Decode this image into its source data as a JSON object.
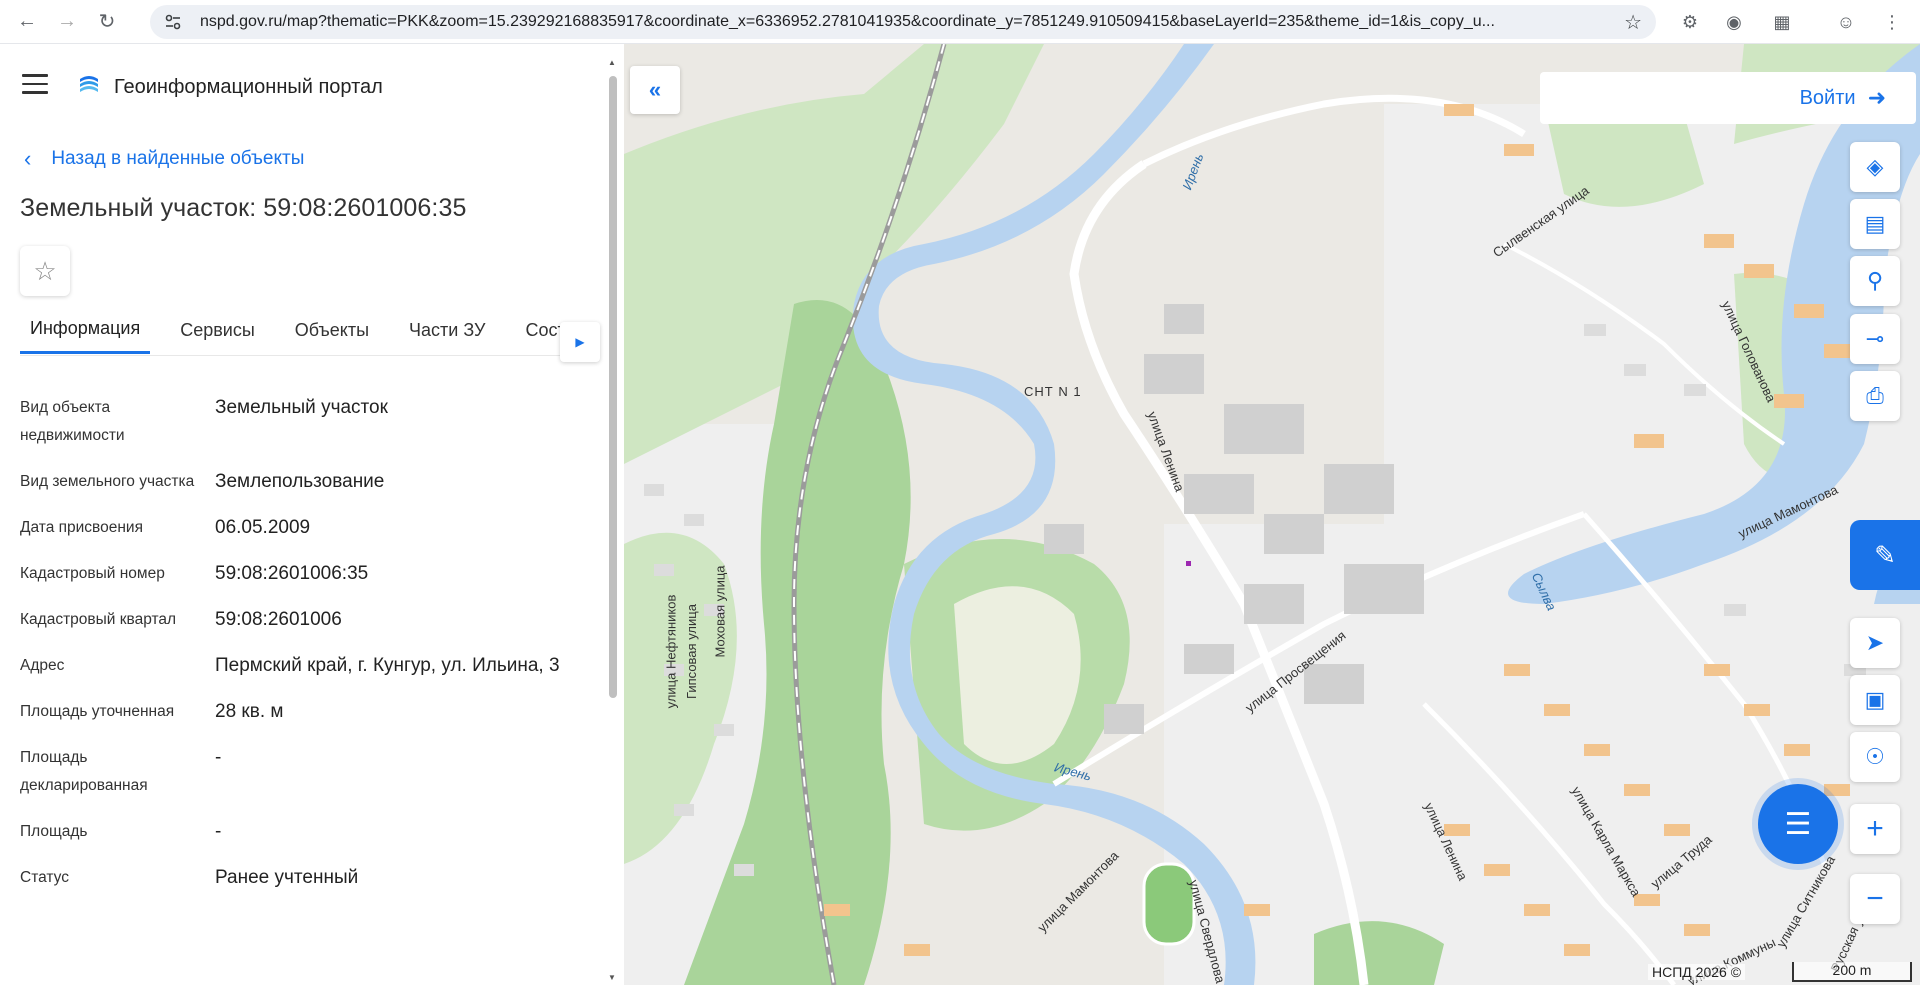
{
  "browser": {
    "url": "nspd.gov.ru/map?thematic=PKK&zoom=15.239292168835917&coordinate_x=6336952.2781041935&coordinate_y=7851249.910509415&baseLayerId=235&theme_id=1&is_copy_u..."
  },
  "header": {
    "title": "Геоинформационный портал"
  },
  "back_link": "Назад в найденные объекты",
  "object": {
    "title": "Земельный участок: 59:08:2601006:35"
  },
  "tabs": [
    {
      "label": "Информация"
    },
    {
      "label": "Сервисы"
    },
    {
      "label": "Объекты"
    },
    {
      "label": "Части ЗУ"
    },
    {
      "label": "Соста"
    }
  ],
  "info": [
    {
      "label": "Вид объекта недвижимости",
      "value": "Земельный участок"
    },
    {
      "label": "Вид земельного участка",
      "value": "Землепользование"
    },
    {
      "label": "Дата присвоения",
      "value": "06.05.2009"
    },
    {
      "label": "Кадастровый номер",
      "value": "59:08:2601006:35"
    },
    {
      "label": "Кадастровый квартал",
      "value": "59:08:2601006"
    },
    {
      "label": "Адрес",
      "value": "Пермский край, г. Кунгур, ул. Ильина, 3"
    },
    {
      "label": "Площадь уточненная",
      "value": "28 кв. м"
    },
    {
      "label": "Площадь декларированная",
      "value": "-"
    },
    {
      "label": "Площадь",
      "value": "-"
    },
    {
      "label": "Статус",
      "value": "Ранее учтенный"
    }
  ],
  "map": {
    "login_label": "Войти",
    "attribution": "НСПД 2026 ©",
    "scale": "200 m",
    "labels": {
      "snt": "СНТ N 1",
      "irgen1": "Ирень",
      "irgen2": "Ирень",
      "sylva": "Сылва",
      "lenina1": "улица Ленина",
      "lenina2": "улица Ленина",
      "prosv": "улица Просвещения",
      "sylvenskaya": "Сылвенская улица",
      "golovanova": "улица Голованова",
      "mamontova1": "улица Мамонтова",
      "mamontova2": "улица Мамонтова",
      "neftyanikov": "улица Нефтяников",
      "gipsovaya": "Гипсовая улица",
      "mokhovaya": "Моховая улица",
      "sverdlova": "улица Свердлова",
      "karla_marksa": "улица Карла Маркса",
      "truda": "улица Труда",
      "kommuny": "улица Коммуны",
      "sitnikova": "улица Ситникова",
      "russkaya": "Русская улица"
    }
  },
  "colors": {
    "accent": "#1a73e8",
    "river": "#b7d3f0",
    "forest": "#a9d49a",
    "buildings": "#d4d4d4",
    "residential": "#f2c48d"
  }
}
